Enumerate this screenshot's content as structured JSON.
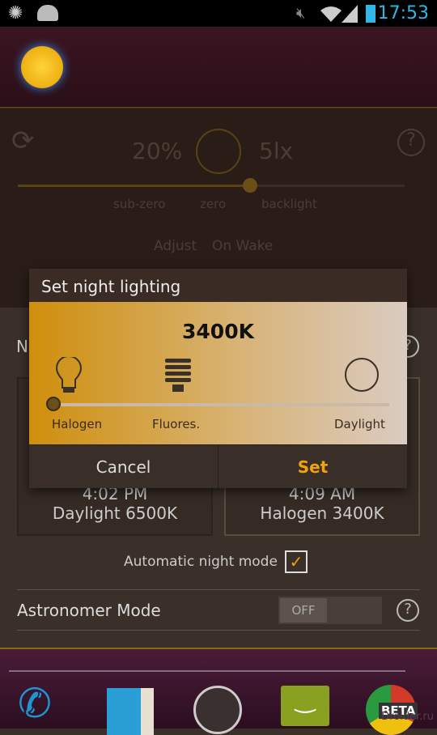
{
  "status_bar": {
    "time": "17:53",
    "icons": [
      "brightness-icon",
      "cyanogen-android-icon",
      "mute-icon",
      "wifi-icon",
      "signal-icon",
      "battery-icon"
    ]
  },
  "header": {
    "logo": "sun-moon-logo"
  },
  "brightness": {
    "percent": "20%",
    "lux": "5lx",
    "labels": [
      "sub-zero",
      "zero",
      "backlight"
    ],
    "adjust_label": "Adjust",
    "adjust_value": "On Wake"
  },
  "section": {
    "heading_partial": "N"
  },
  "cards": [
    {
      "time": "4:02 PM",
      "mode": "Daylight 6500K"
    },
    {
      "time": "4:09 AM",
      "mode": "Halogen 3400K"
    }
  ],
  "auto_night": {
    "label": "Automatic night mode",
    "checked": true
  },
  "astronomer": {
    "label": "Astronomer Mode",
    "toggle": "OFF"
  },
  "dialog": {
    "title": "Set night lighting",
    "value": "3400K",
    "slider_fraction": 0,
    "stops": [
      "Halogen",
      "Fluores.",
      "Daylight"
    ],
    "cancel": "Cancel",
    "set": "Set"
  },
  "dock": {
    "apps": [
      "phone-icon",
      "contacts-icon",
      "clock-icon",
      "messaging-icon",
      "chrome-beta-icon"
    ],
    "chrome_badge": "BETA"
  },
  "watermark": "Droider.ru",
  "colors": {
    "accent": "#f0a30a",
    "status_clock": "#33b5e5"
  }
}
